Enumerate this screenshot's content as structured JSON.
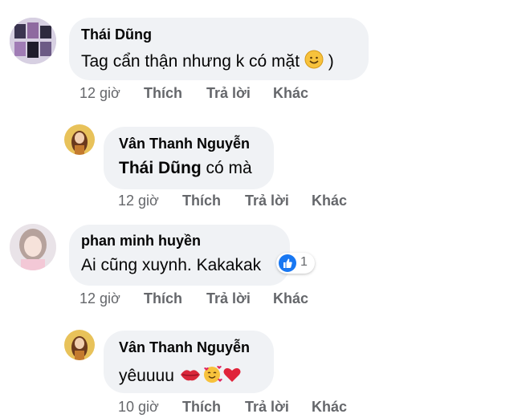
{
  "comments": [
    {
      "author": "Thái Dũng",
      "text": "Tag cẩn thận nhưng k có mặt",
      "text_suffix": ")",
      "time": "12 giờ",
      "like": "Thích",
      "reply": "Trả lời",
      "more": "Khác"
    },
    {
      "author": "Vân Thanh Nguyễn",
      "mention": "Thái Dũng",
      "text": " có mà",
      "time": "12 giờ",
      "like": "Thích",
      "reply": "Trả lời",
      "more": "Khác"
    },
    {
      "author": "phan minh huyền",
      "text": "Ai cũng xuynh. Kakakak",
      "reaction_count": "1",
      "time": "12 giờ",
      "like": "Thích",
      "reply": "Trả lời",
      "more": "Khác"
    },
    {
      "author": "Vân Thanh Nguyễn",
      "text": "yêuuuu",
      "time": "10 giờ",
      "like": "Thích",
      "reply": "Trả lời",
      "more": "Khác"
    }
  ],
  "colors": {
    "bubble": "#f0f2f5",
    "meta": "#65676b",
    "like_blue": "#1877f2"
  }
}
